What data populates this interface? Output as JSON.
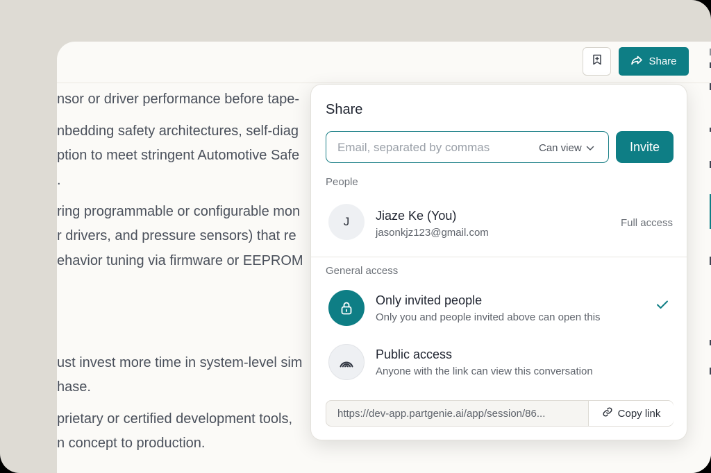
{
  "topbar": {
    "share_label": "Share"
  },
  "document": {
    "lines": [
      "nsor or driver performance before tape-",
      "nbedding safety architectures, self-diag",
      "ption to meet stringent Automotive Safe",
      ".",
      "ring programmable or configurable mon",
      "r drivers, and pressure sensors) that re",
      "ehavior tuning via firmware or EEPROM",
      "ust invest more time in system-level sim",
      "hase.",
      "prietary or certified development tools,",
      "n concept to production."
    ]
  },
  "share_dialog": {
    "title": "Share",
    "email_placeholder": "Email, separated by commas",
    "permission": "Can view",
    "invite_label": "Invite",
    "people_label": "People",
    "person": {
      "initial": "J",
      "name": "Jiaze Ke (You)",
      "email": "jasonkjz123@gmail.com",
      "access": "Full access"
    },
    "general_access_label": "General access",
    "options": [
      {
        "title": "Only invited people",
        "description": "Only you and people invited above can open this",
        "selected": true,
        "icon": "lock-icon"
      },
      {
        "title": "Public access",
        "description": "Anyone with the link can view this conversation",
        "selected": false,
        "icon": "broadcast-icon"
      }
    ],
    "link_url": "https://dev-app.partgenie.ai/app/session/86...",
    "copy_label": "Copy link"
  },
  "colors": {
    "accent": "#0e7e85",
    "frame_background": "#dedbd4",
    "app_background": "#fbfaf7"
  }
}
